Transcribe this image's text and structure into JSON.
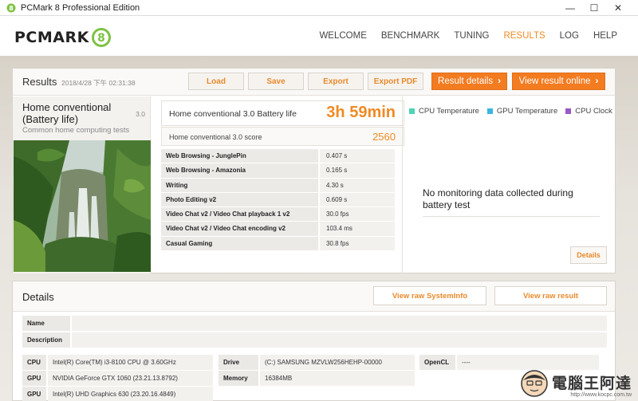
{
  "window": {
    "title": "PCMark 8 Professional Edition",
    "minimize": "—",
    "maximize": "☐",
    "close": "✕"
  },
  "logo": {
    "text": "PCMARK",
    "badge": "8"
  },
  "nav": [
    "WELCOME",
    "BENCHMARK",
    "TUNING",
    "RESULTS",
    "LOG",
    "HELP"
  ],
  "results": {
    "title": "Results",
    "date": "2018/4/28 下午 02:31:38",
    "buttons": {
      "load": "Load",
      "save": "Save",
      "export": "Export",
      "export_pdf": "Export PDF",
      "result_details": "Result details",
      "view_online": "View result online"
    },
    "test": {
      "name": "Home conventional (Battery life)",
      "version": "3.0",
      "subtitle": "Common home computing tests"
    },
    "main_score": {
      "label": "Home conventional 3.0 Battery life",
      "value": "3h 59min"
    },
    "sub_score": {
      "label": "Home conventional 3.0 score",
      "value": "2560"
    },
    "subtests": [
      {
        "name": "Web Browsing - JunglePin",
        "value": "0.407 s"
      },
      {
        "name": "Web Browsing - Amazonia",
        "value": "0.165 s"
      },
      {
        "name": "Writing",
        "value": "4.30 s"
      },
      {
        "name": "Photo Editing v2",
        "value": "0.609 s"
      },
      {
        "name": "Video Chat v2 / Video Chat playback 1 v2",
        "value": "30.0 fps"
      },
      {
        "name": "Video Chat v2 / Video Chat encoding v2",
        "value": "103.4 ms"
      },
      {
        "name": "Casual Gaming",
        "value": "30.8 fps"
      }
    ],
    "legend": [
      {
        "label": "CPU Temperature",
        "color": "#4fd3b8"
      },
      {
        "label": "GPU Temperature",
        "color": "#3bb5e0"
      },
      {
        "label": "CPU Clock",
        "color": "#9b59c6"
      }
    ],
    "no_data": "No monitoring data collected during battery test",
    "details_button": "Details"
  },
  "details": {
    "title": "Details",
    "view_systeminfo": "View raw SystemInfo",
    "view_raw_result": "View raw result",
    "name_label": "Name",
    "description_label": "Description",
    "cpu_label": "CPU",
    "cpu_value": "Intel(R) Core(TM) i3-8100 CPU @ 3.60GHz",
    "gpu1_label": "GPU",
    "gpu1_value": "NVIDIA GeForce GTX 1060 (23.21.13.8792)",
    "gpu2_label": "GPU",
    "gpu2_value": "Intel(R) UHD Graphics 630 (23.20.16.4849)",
    "drive_label": "Drive",
    "drive_value": "(C:) SAMSUNG MZVLW256HEHP-00000",
    "memory_label": "Memory",
    "memory_value": "16384MB",
    "opencl_label": "OpenCL",
    "opencl_value": "----"
  },
  "watermark": {
    "text": "電腦王阿達",
    "url": "http://www.kocpc.com.tw"
  }
}
